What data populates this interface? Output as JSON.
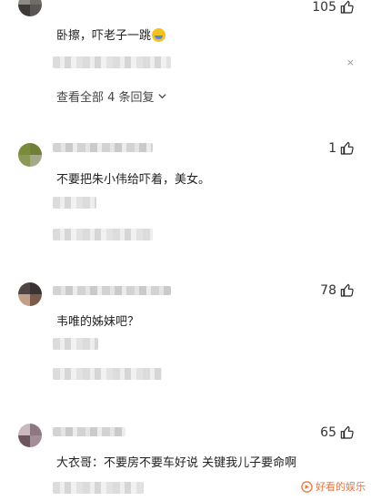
{
  "comments": [
    {
      "likes": "105",
      "text": "卧擦，吓老子一跳",
      "emoji_icon": "crying-laughing-emoji-icon",
      "view_all": "查看全部 4 条回复"
    },
    {
      "likes": "1",
      "text": "不要把朱小伟给吓着，美女。"
    },
    {
      "likes": "78",
      "text": "韦唯的姊妹吧？"
    },
    {
      "likes": "65",
      "text": "大衣哥：不要房不要车好说 关键我儿子要命啊"
    }
  ],
  "icons": {
    "like": "thumbs-up-icon",
    "dismiss": "close-icon",
    "expand": "chevron-down-icon"
  },
  "close_glyph": "×",
  "watermark": "好看的娱乐",
  "colors": {
    "text": "#222222",
    "muted": "#9a9a9a",
    "watermark": "#e8763c"
  }
}
